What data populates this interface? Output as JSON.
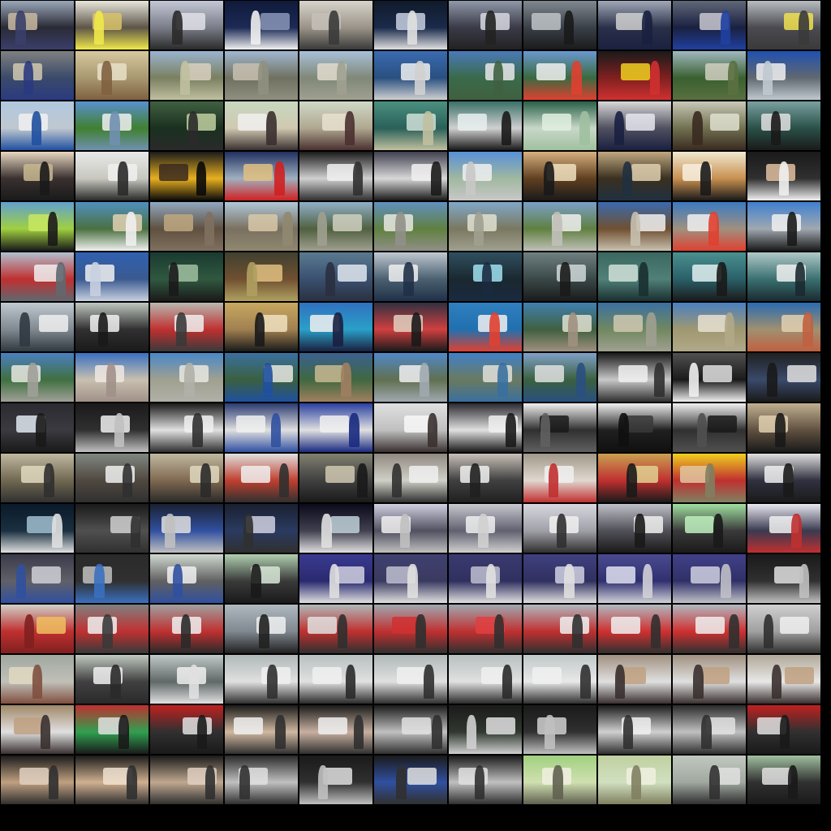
{
  "mosaic": {
    "rows": 16,
    "cols": 11,
    "tiles": [
      [
        [
          "#9aa7b8",
          "#2a2a36",
          "#c9b9a0",
          "#3a3f6a"
        ],
        [
          "#e8e6dc",
          "#5d5548",
          "#d8c36a",
          "#f0e84a"
        ],
        [
          "#c4c8d6",
          "#7a7d88",
          "#e0e0e8",
          "#2a2a2a"
        ],
        [
          "#0f1a3a",
          "#1d2a55",
          "#8a97b8",
          "#f0f0f0"
        ],
        [
          "#d8d4cc",
          "#9a9488",
          "#c4c0b8",
          "#3a3a3a"
        ],
        [
          "#101a2a",
          "#1a2a4a",
          "#c8d0e0",
          "#e0e0e0"
        ],
        [
          "#9098a8",
          "#3a3a48",
          "#d8d8e0",
          "#222222"
        ],
        [
          "#808890",
          "#3a4048",
          "#c0c4c8",
          "#1a1a1a"
        ],
        [
          "#a0a8b8",
          "#2a3048",
          "#d0d0d0",
          "#1a2040"
        ],
        [
          "#606878",
          "#1a2040",
          "#c8c8d0",
          "#2040a0"
        ],
        [
          "#b8bcc0",
          "#4a4a50",
          "#f0e050",
          "#3a3a3a"
        ]
      ],
      [
        [
          "#808080",
          "#3a4a6a",
          "#d0c8b0",
          "#2a3a80"
        ],
        [
          "#d8c8a0",
          "#a89870",
          "#e8e0c8",
          "#806040"
        ],
        [
          "#9ab4d0",
          "#7a8060",
          "#d8d0c0",
          "#c0c0a0"
        ],
        [
          "#a0b8d0",
          "#707060",
          "#c8c0b0",
          "#909080"
        ],
        [
          "#a8c0d8",
          "#808878",
          "#e0dccc",
          "#a0a090"
        ],
        [
          "#3a6ab0",
          "#2a5080",
          "#f0f0f0",
          "#d0d0d0"
        ],
        [
          "#4a7ab8",
          "#3a6a4a",
          "#e8e8e8",
          "#406040"
        ],
        [
          "#6a98d0",
          "#3a6a40",
          "#f0f0f0",
          "#e04030"
        ],
        [
          "#1a1a1a",
          "#802020",
          "#f0d020",
          "#d03030"
        ],
        [
          "#a0b8c0",
          "#3a6030",
          "#d0d0c0",
          "#5a7040"
        ],
        [
          "#2050b0",
          "#606870",
          "#f0f0f0",
          "#c0c8d0"
        ]
      ],
      [
        [
          "#b0c8e0",
          "#c0c8d0",
          "#f0f0f0",
          "#2050a0"
        ],
        [
          "#5a90d0",
          "#408030",
          "#f0f0f0",
          "#7090b0"
        ],
        [
          "#406040",
          "#1a3020",
          "#c0d0a0",
          "#2a2a2a"
        ],
        [
          "#c8d8c0",
          "#d0c8b0",
          "#f0f0f0",
          "#3a3030"
        ],
        [
          "#d0d8c8",
          "#b0a890",
          "#e8e0d0",
          "#4a3030"
        ],
        [
          "#4a9080",
          "#2a6058",
          "#d0e0d8",
          "#c0c0a0"
        ],
        [
          "#3a7068",
          "#d0d0d0",
          "#e8f0f0",
          "#1a1a1a"
        ],
        [
          "#2a6048",
          "#c8d8c8",
          "#e0f0e0",
          "#a0c0a0"
        ],
        [
          "#d8d8d8",
          "#505060",
          "#e8e8f0",
          "#1a2040"
        ],
        [
          "#c8c8b8",
          "#707050",
          "#e0e0d0",
          "#3a2a20"
        ],
        [
          "#7aa0a0",
          "#2a5048",
          "#e0e0e0",
          "#1a1a1a"
        ]
      ],
      [
        [
          "#e8d8c0",
          "#3a3030",
          "#c8b890",
          "#1a1a1a"
        ],
        [
          "#e8e8e8",
          "#c8c8c0",
          "#f0f0f0",
          "#2a2a2a"
        ],
        [
          "#1a1a1a",
          "#e8b020",
          "#3a2a20",
          "#0a0a0a"
        ],
        [
          "#203060",
          "#a0b0c0",
          "#e0c080",
          "#d02020"
        ],
        [
          "#1a1a1a",
          "#d0d0d0",
          "#f0f0f0",
          "#303030"
        ],
        [
          "#404050",
          "#d8d8d8",
          "#f0f0f0",
          "#1a1a1a"
        ],
        [
          "#5890d8",
          "#a0b8a0",
          "#f0f0f0",
          "#c8c8c8"
        ],
        [
          "#d8b080",
          "#604020",
          "#f0e0c0",
          "#1a1a1a"
        ],
        [
          "#c0a880",
          "#3a3020",
          "#e0d0b0",
          "#203040"
        ],
        [
          "#f0e8d0",
          "#c89050",
          "#f8f0e0",
          "#1a1a1a"
        ],
        [
          "#1a1a1a",
          "#303030",
          "#e0c0a0",
          "#f0f0f0"
        ]
      ],
      [
        [
          "#60a0d0",
          "#a0d040",
          "#c8e860",
          "#1a1a1a"
        ],
        [
          "#5090c0",
          "#4a7040",
          "#e0d0b0",
          "#f0f0f0"
        ],
        [
          "#90a8c0",
          "#605040",
          "#c0a880",
          "#807060"
        ],
        [
          "#b0c8d8",
          "#7a7060",
          "#d8c8a8",
          "#908870"
        ],
        [
          "#90b0c8",
          "#506040",
          "#d0d0c0",
          "#a0a090"
        ],
        [
          "#6090c0",
          "#608040",
          "#e8e8e0",
          "#909088"
        ],
        [
          "#80a8c8",
          "#7a7860",
          "#e0e0d0",
          "#a0a090"
        ],
        [
          "#7aa0c8",
          "#608040",
          "#f0f0f0",
          "#c0c0b8"
        ],
        [
          "#3a6ab0",
          "#705030",
          "#f0f0f0",
          "#c8c0b0"
        ],
        [
          "#3a7ac0",
          "#a09080",
          "#f0f0f0",
          "#e04030"
        ],
        [
          "#4080d0",
          "#a0a8b0",
          "#f0f0f0",
          "#1a1a1a"
        ]
      ],
      [
        [
          "#b0c0d0",
          "#c03030",
          "#f0f0f0",
          "#606870"
        ],
        [
          "#3060b0",
          "#3a5a90",
          "#f0f0f0",
          "#c8d0e0"
        ],
        [
          "#1a3a30",
          "#305840",
          "#a0c0a0",
          "#1a1a1a"
        ],
        [
          "#404030",
          "#705030",
          "#e0c080",
          "#b0a060"
        ],
        [
          "#5a7a90",
          "#3a5070",
          "#e0e8f0",
          "#2a3040"
        ],
        [
          "#c0c8d0",
          "#4a6070",
          "#f0f0f0",
          "#203048"
        ],
        [
          "#305060",
          "#1a2830",
          "#a0e0f0",
          "#1a2a40"
        ],
        [
          "#708080",
          "#3a4848",
          "#d0d8d8",
          "#1a1a1a"
        ],
        [
          "#3a6860",
          "#508078",
          "#d0e0d8",
          "#1a3030"
        ],
        [
          "#4a9090",
          "#2a6068",
          "#e0f0f0",
          "#1a1a1a"
        ],
        [
          "#b0c8c8",
          "#3a7070",
          "#f0f0f0",
          "#1a2a30"
        ]
      ],
      [
        [
          "#c0c8d0",
          "#808890",
          "#f0f0f0",
          "#303840"
        ],
        [
          "#c0c8c0",
          "#303030",
          "#f0f0f0",
          "#1a1a1a"
        ],
        [
          "#b8b8b0",
          "#c03030",
          "#f0f0f0",
          "#3a3a3a"
        ],
        [
          "#c8a860",
          "#a08050",
          "#f0e0c0",
          "#1a1a1a"
        ],
        [
          "#3070c0",
          "#2aa0c8",
          "#f0f0f0",
          "#1a2040"
        ],
        [
          "#303040",
          "#d04040",
          "#e0d0c0",
          "#1a1a1a"
        ],
        [
          "#3080c0",
          "#2070b0",
          "#f0f0f0",
          "#e04030"
        ],
        [
          "#4080b0",
          "#406040",
          "#e0e0d0",
          "#a09080"
        ],
        [
          "#3a70a0",
          "#708860",
          "#d0c8b0",
          "#a0a090"
        ],
        [
          "#4a80c0",
          "#a09870",
          "#e8e0d0",
          "#b0a888"
        ],
        [
          "#2a6ab0",
          "#a09070",
          "#e0d0b0",
          "#c06040"
        ]
      ],
      [
        [
          "#4a80c0",
          "#407040",
          "#e8e8e0",
          "#a0a098"
        ],
        [
          "#3a70c0",
          "#c8c0b0",
          "#f0e8e0",
          "#a09088"
        ],
        [
          "#4a88c8",
          "#a0a090",
          "#e8e8e0",
          "#b0b0a8"
        ],
        [
          "#3a70a0",
          "#3a6040",
          "#e8e8e0",
          "#2050a0"
        ],
        [
          "#3a6090",
          "#406840",
          "#c8b890",
          "#a08060"
        ],
        [
          "#5088c8",
          "#607050",
          "#f0f0f0",
          "#a0a8b0"
        ],
        [
          "#4080c8",
          "#6a7a60",
          "#e0e0d8",
          "#3a70a0"
        ],
        [
          "#80a0c8",
          "#3a6040",
          "#e0e0e0",
          "#2a5080"
        ],
        [
          "#1a1a1a",
          "#c8c8c8",
          "#f0f0f0",
          "#303030"
        ],
        [
          "#505050",
          "#1a1a1a",
          "#e0e0e0",
          "#f0f0f0"
        ],
        [
          "#202020",
          "#3a4a6a",
          "#e0e0e0",
          "#1a1a1a"
        ]
      ],
      [
        [
          "#2a2a30",
          "#3a3a40",
          "#e0e8f0",
          "#1a1a1a"
        ],
        [
          "#1a1a1a",
          "#303030",
          "#f0f0f0",
          "#c0c0c0"
        ],
        [
          "#1a1a1a",
          "#e0e0e0",
          "#f0f0f0",
          "#303030"
        ],
        [
          "#2a3a70",
          "#e0e0e0",
          "#f0f0f0",
          "#3050a0"
        ],
        [
          "#2a40a0",
          "#e0e0e0",
          "#f0f0f0",
          "#1a2a80"
        ],
        [
          "#e0e0e0",
          "#c0c0c0",
          "#f8f8f8",
          "#3a3030"
        ],
        [
          "#2a2a30",
          "#e0e0e0",
          "#f0f0f0",
          "#1a1a1a"
        ],
        [
          "#f0f0f0",
          "#303030",
          "#1a1a1a",
          "#606060"
        ],
        [
          "#f0f0f0",
          "#202020",
          "#3a3a3a",
          "#101010"
        ],
        [
          "#f0f0f0",
          "#303030",
          "#1a1a1a",
          "#505050"
        ],
        [
          "#c0b090",
          "#605040",
          "#e0d0b0",
          "#1a1a1a"
        ]
      ],
      [
        [
          "#c0b8a0",
          "#706850",
          "#e0d8c0",
          "#303030"
        ],
        [
          "#808880",
          "#504840",
          "#f0f0f0",
          "#303030"
        ],
        [
          "#c0b8a0",
          "#806850",
          "#e0d8c0",
          "#2a2a2a"
        ],
        [
          "#e0e0e0",
          "#c04030",
          "#f0f0f0",
          "#303030"
        ],
        [
          "#808070",
          "#404040",
          "#d0c8b0",
          "#1a1a1a"
        ],
        [
          "#908880",
          "#d0d0c8",
          "#f0f0f0",
          "#303030"
        ],
        [
          "#c8c0b8",
          "#404040",
          "#f0f0f0",
          "#202020"
        ],
        [
          "#a09888",
          "#e0d8d0",
          "#f0f0f0",
          "#c03030"
        ],
        [
          "#c8a050",
          "#c03030",
          "#e0d090",
          "#1a1a1a"
        ],
        [
          "#f0d020",
          "#c03030",
          "#e0c8a0",
          "#808060"
        ],
        [
          "#e0e0e0",
          "#303040",
          "#f0f0f0",
          "#1a1a1a"
        ]
      ],
      [
        [
          "#0a1a2a",
          "#1a3040",
          "#a0c0d0",
          "#e0e0e0"
        ],
        [
          "#1a1a1a",
          "#505050",
          "#d0d0d0",
          "#303030"
        ],
        [
          "#1a2030",
          "#3050a0",
          "#e0e0e0",
          "#c0c0c0"
        ],
        [
          "#1a2030",
          "#2a3a60",
          "#d0d0e0",
          "#303030"
        ],
        [
          "#0a0a1a",
          "#404050",
          "#c0d0d8",
          "#e0e0e0"
        ],
        [
          "#d0d0e0",
          "#505060",
          "#f0f0f0",
          "#c0c0c0"
        ],
        [
          "#c8c8d0",
          "#606070",
          "#f0f0f0",
          "#d0d0d0"
        ],
        [
          "#d8d8e0",
          "#a0a0a8",
          "#f0f0f0",
          "#303030"
        ],
        [
          "#c0c0c8",
          "#505058",
          "#f0f0f0",
          "#1a1a1a"
        ],
        [
          "#a0e0a0",
          "#3a3a3a",
          "#c0f0c0",
          "#1a1a1a"
        ],
        [
          "#e8e8f0",
          "#3a3a50",
          "#f0f0f0",
          "#c03030"
        ]
      ],
      [
        [
          "#3a3a4a",
          "#606068",
          "#d0d0d8",
          "#3050a0"
        ],
        [
          "#2a2a2a",
          "#303030",
          "#c0c0c0",
          "#3a70c0"
        ],
        [
          "#d0d8d0",
          "#606060",
          "#f0f0f0",
          "#3050a0"
        ],
        [
          "#b0d0b0",
          "#3a3a3a",
          "#d8e8d8",
          "#1a1a1a"
        ],
        [
          "#3a3a90",
          "#2a2a70",
          "#d0d0e0",
          "#e0e0e0"
        ],
        [
          "#404070",
          "#3a3a60",
          "#c0c0d0",
          "#e0e0e0"
        ],
        [
          "#3a3a70",
          "#303060",
          "#c0c0d0",
          "#e0e0e0"
        ],
        [
          "#404080",
          "#303060",
          "#d0d0e0",
          "#e0e0e0"
        ],
        [
          "#4a4a90",
          "#303070",
          "#e0e0f0",
          "#d0d0d8"
        ],
        [
          "#404088",
          "#303068",
          "#d0d0e0",
          "#c0c0c8"
        ],
        [
          "#1a1a1a",
          "#303030",
          "#e0e0e0",
          "#c0c0c0"
        ]
      ],
      [
        [
          "#d0d0c8",
          "#c03030",
          "#f0c060",
          "#802020"
        ],
        [
          "#808080",
          "#c03030",
          "#f0f0f0",
          "#3a3a3a"
        ],
        [
          "#a0a0a0",
          "#c03030",
          "#f0f0f0",
          "#2a2a2a"
        ],
        [
          "#b0b8c0",
          "#808890",
          "#f0f0f0",
          "#202020"
        ],
        [
          "#b0b8b8",
          "#c03030",
          "#e0e0e0",
          "#303030"
        ],
        [
          "#a0a8b0",
          "#c03030",
          "#d03030",
          "#303030"
        ],
        [
          "#a0a8b0",
          "#c03030",
          "#e04040",
          "#303030"
        ],
        [
          "#b0b8c0",
          "#c03030",
          "#f0f0f0",
          "#303030"
        ],
        [
          "#b0b8c0",
          "#d03030",
          "#f0f0f0",
          "#303030"
        ],
        [
          "#b0b8c0",
          "#d03030",
          "#f0f0f0",
          "#303030"
        ],
        [
          "#d0d0d0",
          "#a0a0a0",
          "#f0f0f0",
          "#303030"
        ]
      ],
      [
        [
          "#a0a8a0",
          "#c0c0b8",
          "#e0d8c0",
          "#805040"
        ],
        [
          "#c0c8c0",
          "#404040",
          "#f0f0f0",
          "#2a2a2a"
        ],
        [
          "#c0c8c8",
          "#606868",
          "#f0f0f0",
          "#e0e0e0"
        ],
        [
          "#b0b8b8",
          "#e0e0e0",
          "#f0f0f0",
          "#303030"
        ],
        [
          "#b8c0c0",
          "#e0e0e0",
          "#f0f0f0",
          "#2a2a2a"
        ],
        [
          "#b0b8b8",
          "#e0e0e0",
          "#f0f0f0",
          "#303030"
        ],
        [
          "#b8c0c0",
          "#e0e0e0",
          "#f0f0f0",
          "#2a2a2a"
        ],
        [
          "#c0c8c8",
          "#e8e8e8",
          "#f0f0f0",
          "#303030"
        ],
        [
          "#a09080",
          "#e0e0e0",
          "#c0a080",
          "#3a3030"
        ],
        [
          "#a09080",
          "#e0e0e0",
          "#c0a080",
          "#3a3030"
        ],
        [
          "#b0a898",
          "#e8e8e8",
          "#c0a080",
          "#3a3030"
        ]
      ],
      [
        [
          "#a08868",
          "#e0e0e0",
          "#c0a080",
          "#3a3030"
        ],
        [
          "#c03030",
          "#30a050",
          "#e0e0e0",
          "#1a1a1a"
        ],
        [
          "#c02020",
          "#303030",
          "#e0e0e0",
          "#1a1a1a"
        ],
        [
          "#1a1a1a",
          "#d0b8a0",
          "#f0f0f0",
          "#303030"
        ],
        [
          "#1a1a1a",
          "#c8b0a0",
          "#f0f0f0",
          "#303030"
        ],
        [
          "#1a1a1a",
          "#c0c0c0",
          "#e0e0e0",
          "#303030"
        ],
        [
          "#1a1a1a",
          "#303830",
          "#e0e0e0",
          "#d0d0d0"
        ],
        [
          "#1a1a1a",
          "#303030",
          "#d0d0d0",
          "#c0c0c0"
        ],
        [
          "#1a1a1a",
          "#d0d0d0",
          "#f0f0f0",
          "#303030"
        ],
        [
          "#2a2a2a",
          "#c0c0c0",
          "#e0e0e0",
          "#303030"
        ],
        [
          "#c02020",
          "#303030",
          "#e0e0e0",
          "#1a1a1a"
        ]
      ],
      [
        [
          "#1a1a1a",
          "#c0a080",
          "#e0d0c0",
          "#303030"
        ],
        [
          "#1a1a1a",
          "#d0b090",
          "#f0e0d0",
          "#303030"
        ],
        [
          "#1a1a1a",
          "#c0a890",
          "#e0d0c0",
          "#303030"
        ],
        [
          "#2a2a2a",
          "#c0c0c0",
          "#e0e0e0",
          "#303030"
        ],
        [
          "#1a1a1a",
          "#303030",
          "#e0e0e0",
          "#c0c0c0"
        ],
        [
          "#1a1a1a",
          "#3050a0",
          "#e0e0e0",
          "#303030"
        ],
        [
          "#1a1a1a",
          "#c0c0c0",
          "#e0e0e0",
          "#303030"
        ],
        [
          "#a0d080",
          "#d0e0b0",
          "#f0f0e0",
          "#606050"
        ],
        [
          "#c0d0a0",
          "#d0e0c0",
          "#f0f0e0",
          "#808060"
        ],
        [
          "#c0c8c0",
          "#a0a8a0",
          "#e0e0e0",
          "#303030"
        ],
        [
          "#a0c0a0",
          "#303030",
          "#e0e0e0",
          "#1a1a1a"
        ]
      ]
    ]
  }
}
